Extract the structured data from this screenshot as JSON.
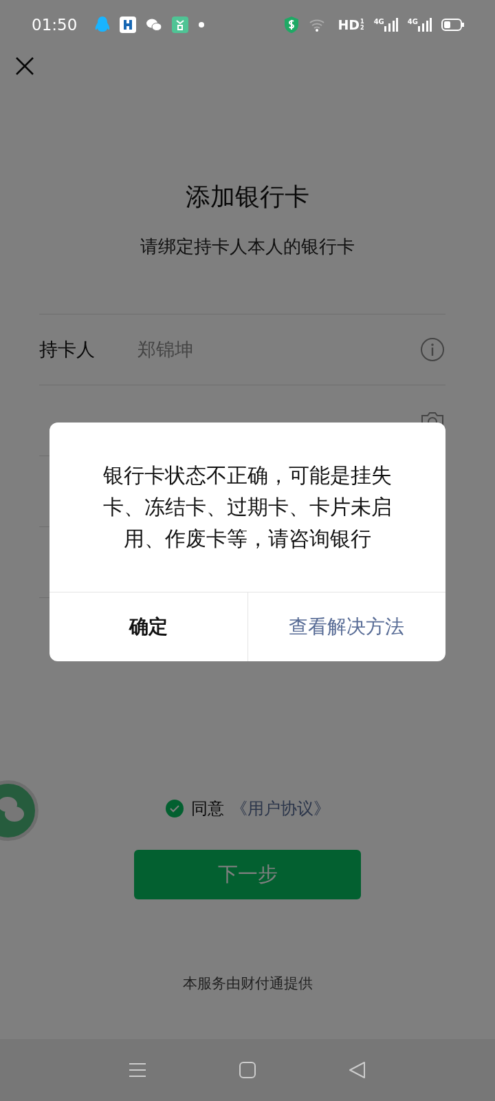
{
  "status_bar": {
    "time": "01:50",
    "hd_label": "HD",
    "hd_slots": [
      "1",
      "2"
    ],
    "sim_labels": [
      "4G",
      "4G"
    ]
  },
  "title": "添加银行卡",
  "subtitle": "请绑定持卡人本人的银行卡",
  "fields": [
    {
      "label": "持卡人",
      "value": "郑锦坤",
      "disabled": true,
      "kind": "info"
    },
    {
      "kind": "camera"
    }
  ],
  "agreement": {
    "checked": true,
    "text": "同意",
    "link": "《用户协议》"
  },
  "next_button": "下一步",
  "footer": "本服务由财付通提供",
  "dialog": {
    "message": "银行卡状态不正确，可能是挂失卡、冻结卡、过期卡、卡片未启用、作废卡等，请咨询银行",
    "buttons": [
      {
        "label": "确定",
        "kind": "default"
      },
      {
        "label": "查看解决方法",
        "kind": "link"
      }
    ]
  }
}
